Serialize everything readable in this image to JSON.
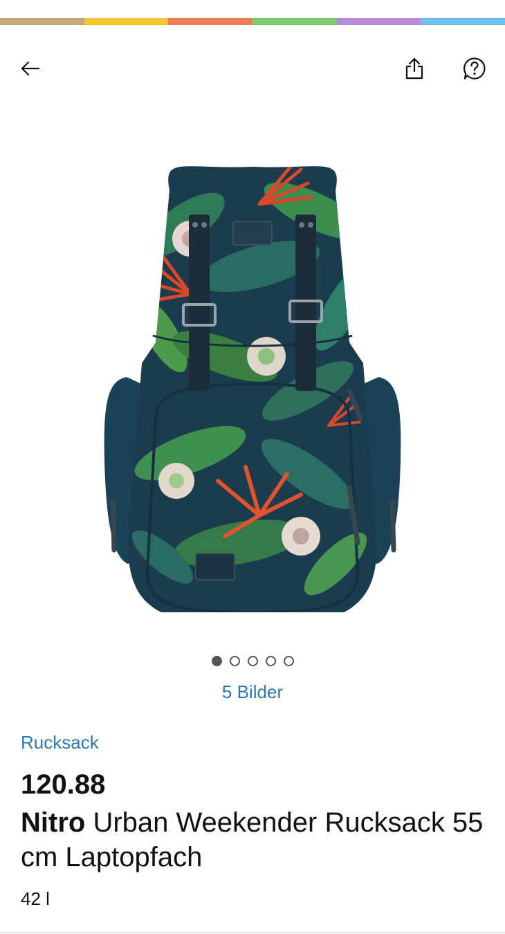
{
  "header": {
    "color_bar": [
      "#c9a77a",
      "#f8c430",
      "#f27d52",
      "#7ccc6c",
      "#b58ad6",
      "#6fbfee"
    ],
    "back_icon": "arrow-left-icon",
    "share_icon": "share-icon",
    "help_icon": "help-icon"
  },
  "gallery": {
    "image": "tropical-print-backpack",
    "dots_total": 5,
    "active_index": 0,
    "images_link": "5 Bilder"
  },
  "product": {
    "category": "Rucksack",
    "price": "120.88",
    "brand": "Nitro",
    "name": " Urban Weekender Rucksack 55 cm Laptopfach",
    "volume": "42 l"
  }
}
